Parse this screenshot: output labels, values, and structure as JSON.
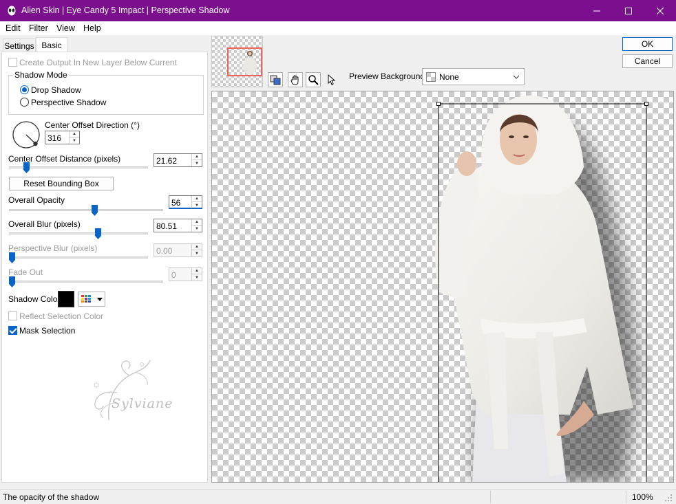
{
  "window": {
    "title": "Alien Skin | Eye Candy 5 Impact | Perspective Shadow",
    "accent_color": "#7b0f8e"
  },
  "menu": [
    "Edit",
    "Filter",
    "View",
    "Help"
  ],
  "tabs": {
    "settings": "Settings",
    "basic": "Basic"
  },
  "options": {
    "create_output_label": "Create Output In New Layer Below Current",
    "shadow_mode_label": "Shadow Mode",
    "drop_shadow_label": "Drop Shadow",
    "perspective_shadow_label": "Perspective Shadow",
    "selected_mode": "Drop Shadow",
    "center_offset_direction_label": "Center Offset Direction (°)",
    "center_offset_direction_value": "316",
    "center_offset_distance_label": "Center Offset Distance (pixels)",
    "center_offset_distance_value": "21.62",
    "reset_bounding_box_label": "Reset Bounding Box",
    "overall_opacity_label": "Overall Opacity",
    "overall_opacity_value": "56",
    "overall_blur_label": "Overall Blur (pixels)",
    "overall_blur_value": "80.51",
    "perspective_blur_label": "Perspective Blur (pixels)",
    "perspective_blur_value": "0.00",
    "fade_out_label": "Fade Out",
    "fade_out_value": "0",
    "shadow_color_label": "Shadow Color",
    "shadow_color": "#000000",
    "reflect_selection_color_label": "Reflect Selection Color",
    "mask_selection_label": "Mask Selection",
    "mask_selection_checked": true
  },
  "sliders": {
    "center_offset_distance": 0.11,
    "overall_opacity": 0.56,
    "overall_blur": 0.65,
    "perspective_blur": 0.0,
    "fade_out": 0.0
  },
  "watermark_text": "Sylviane",
  "preview": {
    "background_label": "Preview Background:",
    "background_value": "None"
  },
  "buttons": {
    "ok": "OK",
    "cancel": "Cancel"
  },
  "status": {
    "text": "The opacity of the shadow",
    "zoom": "100%"
  }
}
